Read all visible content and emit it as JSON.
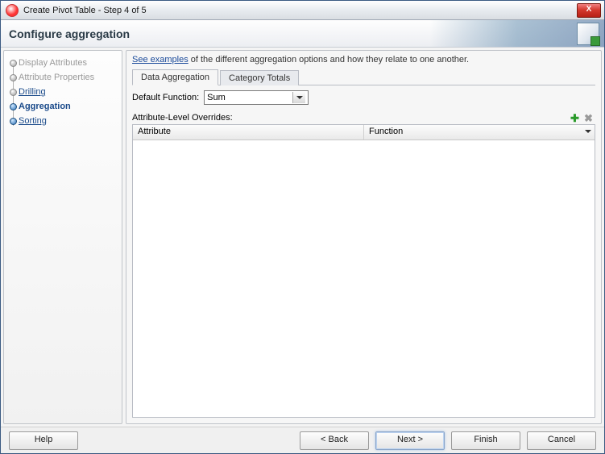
{
  "window": {
    "title": "Create Pivot Table - Step 4 of 5",
    "close_glyph": "X"
  },
  "header": {
    "title": "Configure aggregation"
  },
  "steps": [
    {
      "label": "Display Attributes",
      "state": "disabled"
    },
    {
      "label": "Attribute Properties",
      "state": "disabled"
    },
    {
      "label": "Drilling",
      "state": "link"
    },
    {
      "label": "Aggregation",
      "state": "current"
    },
    {
      "label": "Sorting",
      "state": "link"
    }
  ],
  "hint": {
    "link_text": "See examples",
    "rest": " of the different aggregation options and how they relate to one another."
  },
  "tabs": {
    "data_aggregation": "Data Aggregation",
    "category_totals": "Category Totals",
    "active": 0
  },
  "form": {
    "default_function_label": "Default Function:",
    "default_function_value": "Sum",
    "overrides_label": "Attribute-Level Overrides:"
  },
  "table": {
    "columns": [
      "Attribute",
      "Function"
    ],
    "rows": []
  },
  "buttons": {
    "help": "Help",
    "back": "< Back",
    "next": "Next >",
    "finish": "Finish",
    "cancel": "Cancel"
  },
  "icons": {
    "plus": "✚",
    "delete": "✖"
  }
}
